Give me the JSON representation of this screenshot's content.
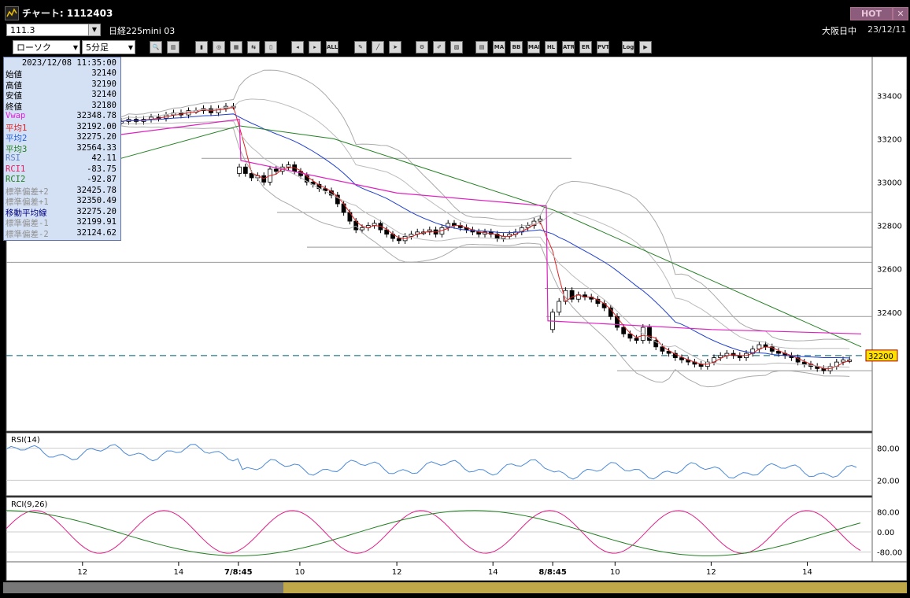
{
  "window": {
    "title": "チャート: 1112403",
    "hot_label": "HOT",
    "close_label": "✕"
  },
  "header": {
    "symbol_code": "111.3",
    "instrument": "日経225mini 03",
    "market": "大阪日中",
    "date": "23/12/11"
  },
  "toolbar": {
    "chart_type": "ローソク",
    "interval": "5分足",
    "buttons": [
      {
        "name": "zoom-icon",
        "label": "🔍"
      },
      {
        "name": "split-icon",
        "label": "▥"
      },
      {
        "name": "candle-icon",
        "label": "▮"
      },
      {
        "name": "search-chart-icon",
        "label": "◎"
      },
      {
        "name": "bar-chart-icon",
        "label": "▦"
      },
      {
        "name": "compare-icon",
        "label": "⇆"
      },
      {
        "name": "disabled-icon",
        "label": "▯"
      },
      {
        "name": "step-left-icon",
        "label": "◂"
      },
      {
        "name": "step-right-icon",
        "label": "▸"
      },
      {
        "name": "all-icon",
        "label": "ALL"
      },
      {
        "name": "pencil-icon",
        "label": "✎"
      },
      {
        "name": "line-draw-icon",
        "label": "╱"
      },
      {
        "name": "pointer-icon",
        "label": "➤"
      },
      {
        "name": "settings-icon",
        "label": "⚙"
      },
      {
        "name": "tool-icon",
        "label": "✐"
      },
      {
        "name": "color-icon",
        "label": "▧"
      },
      {
        "name": "grid-icon",
        "label": "▤"
      },
      {
        "name": "ma-icon",
        "label": "MA"
      },
      {
        "name": "bb-icon",
        "label": "BB"
      },
      {
        "name": "mae-icon",
        "label": "MAE"
      },
      {
        "name": "hl-icon",
        "label": "HL"
      },
      {
        "name": "atr-icon",
        "label": "ATR"
      },
      {
        "name": "chart-icon",
        "label": "ER"
      },
      {
        "name": "pvt-icon",
        "label": "PVT"
      },
      {
        "name": "log-icon",
        "label": "Log"
      },
      {
        "name": "export-icon",
        "label": "▶"
      }
    ]
  },
  "info_panel": {
    "datetime": "2023/12/08  11:35:00",
    "rows": [
      {
        "label": "始値",
        "value": "32140",
        "color": "#000000"
      },
      {
        "label": "高値",
        "value": "32190",
        "color": "#000000"
      },
      {
        "label": "安値",
        "value": "32140",
        "color": "#000000"
      },
      {
        "label": "終値",
        "value": "32180",
        "color": "#000000"
      },
      {
        "label": "Vwap",
        "value": "32348.78",
        "color": "#e020e0"
      },
      {
        "label": "平均1",
        "value": "32192.00",
        "color": "#e02020"
      },
      {
        "label": "平均2",
        "value": "32275.20",
        "color": "#2060e0"
      },
      {
        "label": "平均3",
        "value": "32564.33",
        "color": "#208020"
      },
      {
        "label": "RSI",
        "value": "42.11",
        "color": "#6080c0"
      },
      {
        "label": "RCI1",
        "value": "-83.75",
        "color": "#e02060"
      },
      {
        "label": "RCI2",
        "value": "-92.87",
        "color": "#208020"
      },
      {
        "label": "標準偏差+2",
        "value": "32425.78",
        "color": "#909090"
      },
      {
        "label": "標準偏差+1",
        "value": "32350.49",
        "color": "#909090"
      },
      {
        "label": "移動平均線",
        "value": "32275.20",
        "color": "#000080"
      },
      {
        "label": "標準偏差-1",
        "value": "32199.91",
        "color": "#909090"
      },
      {
        "label": "標準偏差-2",
        "value": "32124.62",
        "color": "#909090"
      }
    ]
  },
  "chart_data": {
    "type": "candlestick",
    "price_axis_ticks": [
      "33400",
      "33200",
      "33000",
      "32800",
      "32600",
      "32400"
    ],
    "ylim": [
      31880,
      33550
    ],
    "current_price_label": "32200",
    "x_ticks": [
      {
        "label": "12",
        "bold": false,
        "frac": 0.088
      },
      {
        "label": "14",
        "bold": false,
        "frac": 0.199
      },
      {
        "label": "7/8:45",
        "bold": true,
        "frac": 0.268
      },
      {
        "label": "10",
        "bold": false,
        "frac": 0.339
      },
      {
        "label": "12",
        "bold": false,
        "frac": 0.451
      },
      {
        "label": "14",
        "bold": false,
        "frac": 0.562
      },
      {
        "label": "8/8:45",
        "bold": true,
        "frac": 0.631
      },
      {
        "label": "10",
        "bold": false,
        "frac": 0.703
      },
      {
        "label": "12",
        "bold": false,
        "frac": 0.814
      },
      {
        "label": "14",
        "bold": false,
        "frac": 0.925
      }
    ],
    "rsi": {
      "label": "RSI(14)",
      "ticks": [
        "80.00",
        "20.00"
      ]
    },
    "rci": {
      "label": "RCI(9,26)",
      "ticks": [
        "80.00",
        "0.00",
        "-80.00"
      ]
    },
    "closes": [
      33280,
      33290,
      33280,
      33290,
      33300,
      33295,
      33310,
      33320,
      33310,
      33330,
      33330,
      33340,
      33320,
      33340,
      33350,
      33350,
      33070,
      33040,
      33020,
      33030,
      33000,
      33060,
      33050,
      33070,
      33080,
      33050,
      33030,
      33000,
      32990,
      32970,
      32960,
      32940,
      32900,
      32860,
      32820,
      32780,
      32790,
      32800,
      32810,
      32780,
      32760,
      32740,
      32730,
      32750,
      32760,
      32770,
      32770,
      32780,
      32760,
      32790,
      32810,
      32800,
      32790,
      32780,
      32770,
      32760,
      32770,
      32760,
      32740,
      32750,
      32760,
      32770,
      32790,
      32800,
      32820,
      32830,
      32400,
      32450,
      32500,
      32460,
      32480,
      32470,
      32460,
      32440,
      32420,
      32380,
      32330,
      32300,
      32280,
      32270,
      32330,
      32270,
      32240,
      32220,
      32210,
      32190,
      32180,
      32170,
      32160,
      32150,
      32170,
      32190,
      32200,
      32210,
      32200,
      32190,
      32210,
      32230,
      32250,
      32240,
      32220,
      32210,
      32200,
      32190,
      32170,
      32160,
      32150,
      32140,
      32130,
      32150,
      32170,
      32180,
      32180
    ]
  }
}
